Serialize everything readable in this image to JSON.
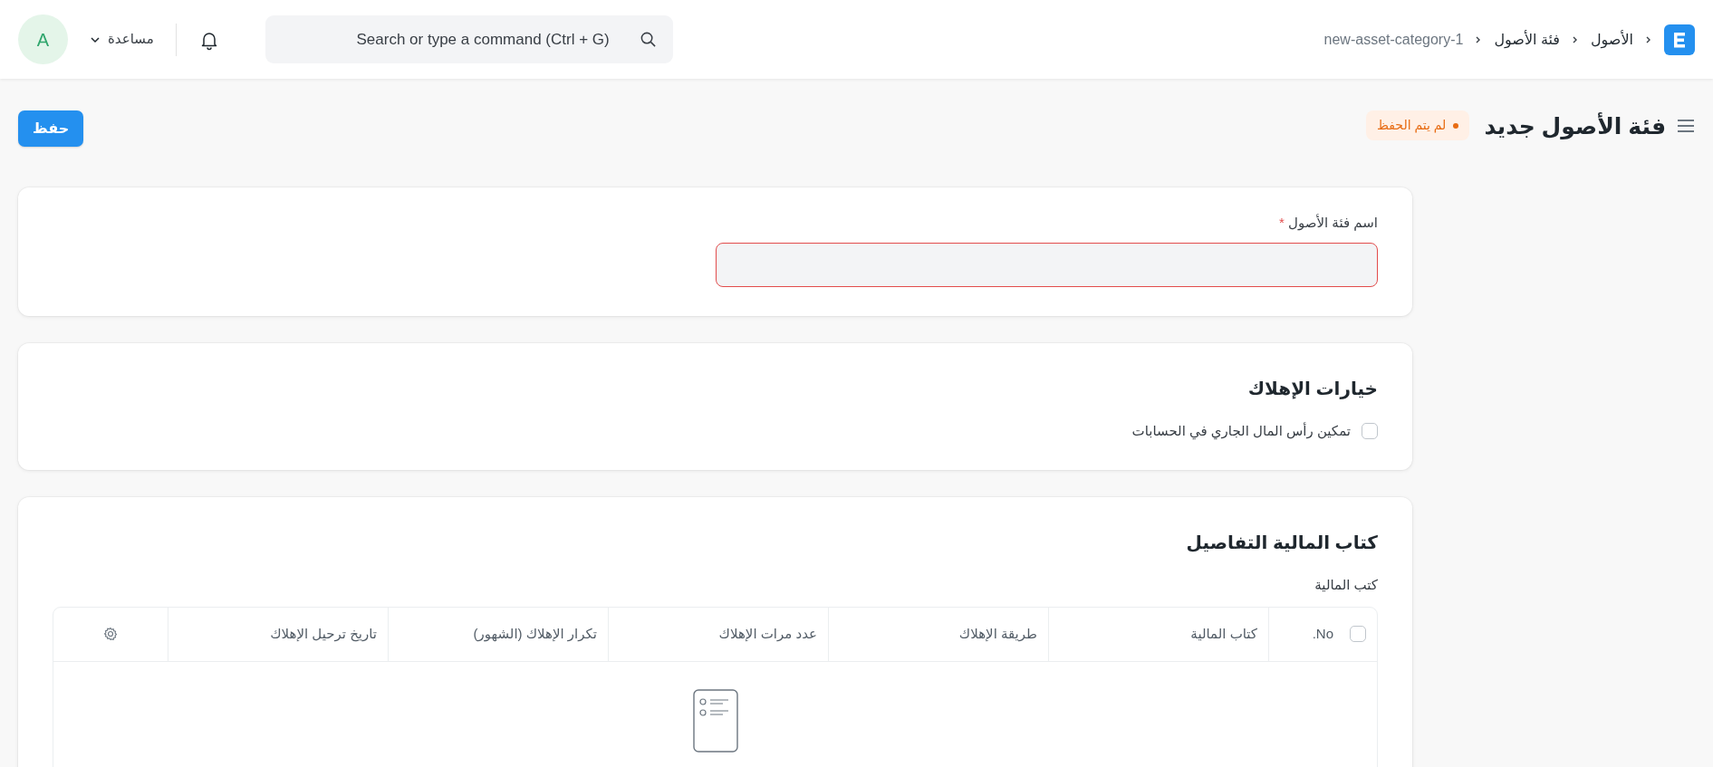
{
  "navbar": {
    "breadcrumbs": [
      {
        "label": "الأصول",
        "current": false
      },
      {
        "label": "فئة الأصول",
        "current": false
      },
      {
        "label": "new-asset-category-1",
        "current": true
      }
    ],
    "search": {
      "placeholder": "Search or type a command (Ctrl + G)"
    },
    "help": {
      "label": "مساعدة"
    },
    "avatar": {
      "initial": "A"
    }
  },
  "page_header": {
    "title": "فئة الأصول جديد",
    "status": "لم يتم الحفظ",
    "save_button": "حفظ"
  },
  "sections": [
    {
      "kind": "fields",
      "fields": [
        {
          "label": "اسم فئة الأصول",
          "required_mark": "*",
          "invalid": true
        }
      ]
    },
    {
      "kind": "checks",
      "title": "خيارات الإهلاك",
      "checks": [
        {
          "label": "تمكين رأس المال الجاري في الحسابات",
          "checked": false
        }
      ]
    },
    {
      "kind": "table",
      "title": "كتاب المالية التفاصيل",
      "table": {
        "label": "كتب المالية",
        "select_all": {
          "checked": false
        },
        "columns": [
          {
            "label": "No."
          },
          {
            "label": "كتاب المالية"
          },
          {
            "label": "طريقة الإهلاك"
          },
          {
            "label": "عدد مرات الإهلاك"
          },
          {
            "label": "تكرار الإهلاك (الشهور)"
          },
          {
            "label": "تاريخ ترحيل الإهلاك"
          }
        ]
      }
    }
  ]
}
